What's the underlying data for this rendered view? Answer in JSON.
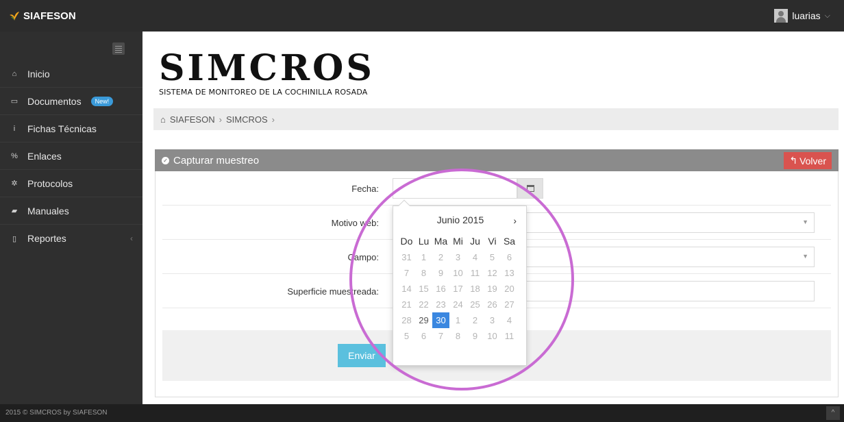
{
  "app": {
    "brand": "SIAFESON",
    "brand_icon": "leaf-logo-icon",
    "user_name": "luarias",
    "user_caret": "⌵"
  },
  "sidebar": {
    "items": [
      {
        "label": "Inicio",
        "icon": "home-icon",
        "glyph": "⌂"
      },
      {
        "label": "Documentos",
        "icon": "folder-icon",
        "glyph": "▭",
        "badge": "New!"
      },
      {
        "label": "Fichas Técnicas",
        "icon": "info-icon",
        "glyph": "i"
      },
      {
        "label": "Enlaces",
        "icon": "link-icon",
        "glyph": "%"
      },
      {
        "label": "Protocolos",
        "icon": "gear-icon",
        "glyph": "✲"
      },
      {
        "label": "Manuales",
        "icon": "book-icon",
        "glyph": "▰"
      },
      {
        "label": "Reportes",
        "icon": "file-icon",
        "glyph": "▯",
        "caret": "‹"
      }
    ]
  },
  "header": {
    "logo_title": "SIMCROS",
    "logo_subtitle": "SISTEMA DE MONITOREO DE LA COCHINILLA ROSADA"
  },
  "breadcrumb": {
    "home_icon": "⌂",
    "items": [
      "SIAFESON",
      "SIMCROS"
    ],
    "separator": "›"
  },
  "panel": {
    "title": "Capturar muestreo",
    "title_icon": "✓",
    "back_button": "Volver",
    "back_icon": "↰"
  },
  "form": {
    "fecha_label": "Fecha:",
    "fecha_value": "",
    "motivo_label": "Motivo web:",
    "campo_label": "Campo:",
    "superficie_label": "Superficie muestreada:",
    "select_arrow": "▼",
    "submit": "Enviar"
  },
  "datepicker": {
    "month_label": "Junio 2015",
    "next": "›",
    "weekdays": [
      "Do",
      "Lu",
      "Ma",
      "Mi",
      "Ju",
      "Vi",
      "Sa"
    ],
    "days": [
      {
        "d": "31",
        "s": "off"
      },
      {
        "d": "1",
        "s": "off"
      },
      {
        "d": "2",
        "s": "off"
      },
      {
        "d": "3",
        "s": "off"
      },
      {
        "d": "4",
        "s": "off"
      },
      {
        "d": "5",
        "s": "off"
      },
      {
        "d": "6",
        "s": "off"
      },
      {
        "d": "7",
        "s": "off"
      },
      {
        "d": "8",
        "s": "off"
      },
      {
        "d": "9",
        "s": "off"
      },
      {
        "d": "10",
        "s": "off"
      },
      {
        "d": "11",
        "s": "off"
      },
      {
        "d": "12",
        "s": "off"
      },
      {
        "d": "13",
        "s": "off"
      },
      {
        "d": "14",
        "s": "off"
      },
      {
        "d": "15",
        "s": "off"
      },
      {
        "d": "16",
        "s": "off"
      },
      {
        "d": "17",
        "s": "off"
      },
      {
        "d": "18",
        "s": "off"
      },
      {
        "d": "19",
        "s": "off"
      },
      {
        "d": "20",
        "s": "off"
      },
      {
        "d": "21",
        "s": "off"
      },
      {
        "d": "22",
        "s": "off"
      },
      {
        "d": "23",
        "s": "off"
      },
      {
        "d": "24",
        "s": "off"
      },
      {
        "d": "25",
        "s": "off"
      },
      {
        "d": "26",
        "s": "off"
      },
      {
        "d": "27",
        "s": "off"
      },
      {
        "d": "28",
        "s": "off"
      },
      {
        "d": "29",
        "s": "cur"
      },
      {
        "d": "30",
        "s": "sel"
      },
      {
        "d": "1",
        "s": "off"
      },
      {
        "d": "2",
        "s": "off"
      },
      {
        "d": "3",
        "s": "off"
      },
      {
        "d": "4",
        "s": "off"
      },
      {
        "d": "5",
        "s": "off"
      },
      {
        "d": "6",
        "s": "off"
      },
      {
        "d": "7",
        "s": "off"
      },
      {
        "d": "8",
        "s": "off"
      },
      {
        "d": "9",
        "s": "off"
      },
      {
        "d": "10",
        "s": "off"
      },
      {
        "d": "11",
        "s": "off"
      }
    ]
  },
  "footer": {
    "text": "2015 © SIMCROS by SIAFESON",
    "scroll_top": "^"
  },
  "colors": {
    "accent_selected": "#3a87e0",
    "back_button": "#d9534f",
    "submit_button": "#5bc0de",
    "annotation_ring": "#c96bd3"
  }
}
